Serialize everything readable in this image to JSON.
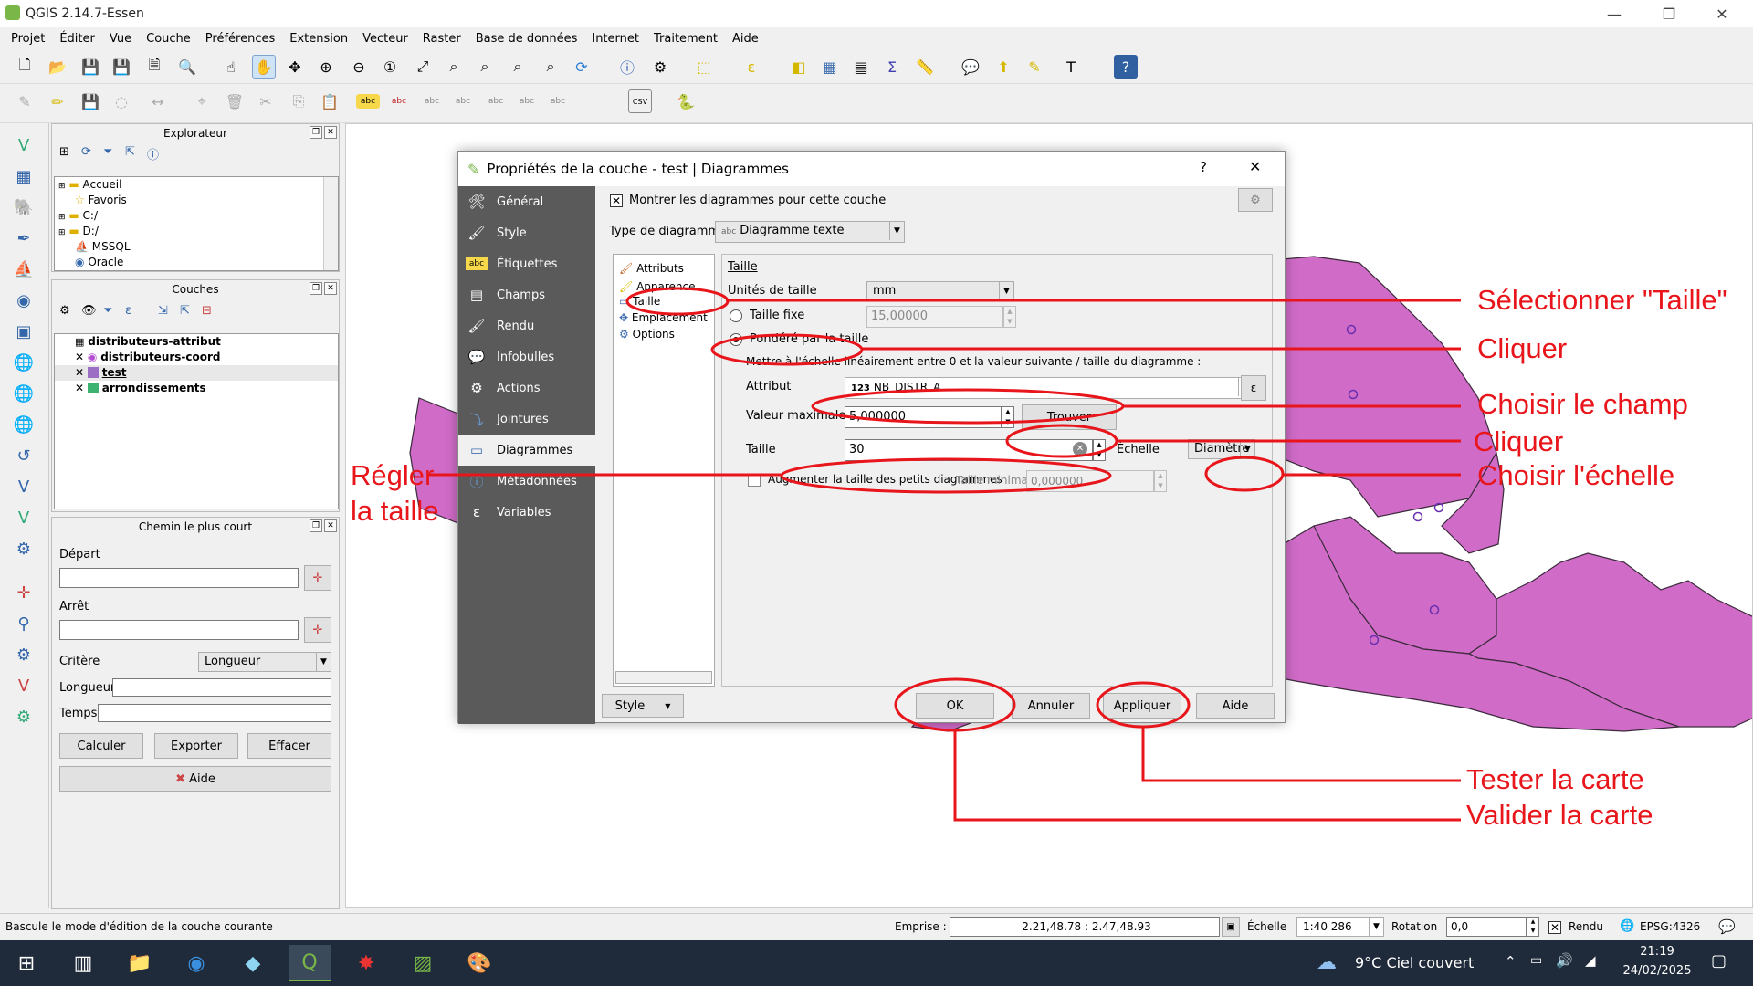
{
  "window": {
    "title": "QGIS 2.14.7-Essen",
    "minimize": "—",
    "maximize": "❐",
    "close": "✕"
  },
  "menu": [
    "Projet",
    "Éditer",
    "Vue",
    "Couche",
    "Préférences",
    "Extension",
    "Vecteur",
    "Raster",
    "Base de données",
    "Internet",
    "Traitement",
    "Aide"
  ],
  "explorer": {
    "title": "Explorateur",
    "items": [
      "Accueil",
      "Favoris",
      "C:/",
      "D:/",
      "MSSQL",
      "Oracle"
    ]
  },
  "layers": {
    "title": "Couches",
    "items": [
      {
        "name": "distributeurs-attribut",
        "checked": false,
        "color": ""
      },
      {
        "name": "distributeurs-coord",
        "checked": true,
        "color": "#b44fd4"
      },
      {
        "name": "test",
        "checked": true,
        "color": "#9b6fc4"
      },
      {
        "name": "arrondissements",
        "checked": true,
        "color": "#3cb371"
      }
    ]
  },
  "route": {
    "title": "Chemin le plus court",
    "depart_label": "Départ",
    "arret_label": "Arrêt",
    "critere_label": "Critère",
    "critere_value": "Longueur",
    "longueur_label": "Longueur",
    "temps_label": "Temps",
    "calc": "Calculer",
    "export": "Exporter",
    "clear": "Effacer",
    "help": "Aide"
  },
  "dialog": {
    "title": "Propriétés de la couche - test | Diagrammes",
    "help_btn": "?",
    "close_btn": "✕",
    "side": [
      "Général",
      "Style",
      "Étiquettes",
      "Champs",
      "Rendu",
      "Infobulles",
      "Actions",
      "Jointures",
      "Diagrammes",
      "Métadonnées",
      "Variables"
    ],
    "show_diagrams": "Montrer les diagrammes pour cette couche",
    "type_label": "Type de diagramme",
    "type_value": "Diagramme texte",
    "type_prefix": "abc",
    "subnav": [
      "Attributs",
      "Apparence",
      "Taille",
      "Emplacement",
      "Options"
    ],
    "size_section": "Taille",
    "units_label": "Unités de taille",
    "units_value": "mm",
    "fixed_label": "Taille fixe",
    "fixed_value": "15,00000",
    "weighted_label": "Pondéré par la taille",
    "scale_note": "Mettre à l'échelle linéairement entre 0 et la valeur suivante / taille du diagramme :",
    "attr_label": "Attribut",
    "attr_prefix": "123",
    "attr_value": "NB_DISTR_A",
    "max_label": "Valeur maximale",
    "max_value": "5,000000",
    "find_btn": "Trouver",
    "size_label": "Taille",
    "size_value": "30",
    "scale_label": "Échelle",
    "scale_value": "Diamètre",
    "increase_label": "Augmenter la taille des petits diagrammes",
    "min_label": "Taille minimale",
    "min_value": "0,000000",
    "style_btn": "Style",
    "ok": "OK",
    "cancel": "Annuler",
    "apply": "Appliquer",
    "help": "Aide"
  },
  "annotations": {
    "select_size": "Sélectionner \"Taille\"",
    "click1": "Cliquer",
    "choose_field": "Choisir le champ",
    "click2": "Cliquer",
    "choose_scale": "Choisir l'échelle",
    "set_size_1": "Régler",
    "set_size_2": "la taille",
    "test_map": "Tester la carte",
    "validate_map": "Valider la carte",
    "color": "#e8151b"
  },
  "status": {
    "message": "Bascule le mode d'édition de la couche courante",
    "emprise_label": "Emprise :",
    "emprise_value": "2.21,48.78 : 2.47,48.93",
    "scale_label": "Échelle",
    "scale_value": "1:40 286",
    "rotation_label": "Rotation",
    "rotation_value": "0,0",
    "render_label": "Rendu",
    "crs": "EPSG:4326"
  },
  "taskbar": {
    "weather": "9°C  Ciel couvert",
    "time": "21:19",
    "date": "24/02/2025"
  },
  "map_fill": "#d06bc8"
}
